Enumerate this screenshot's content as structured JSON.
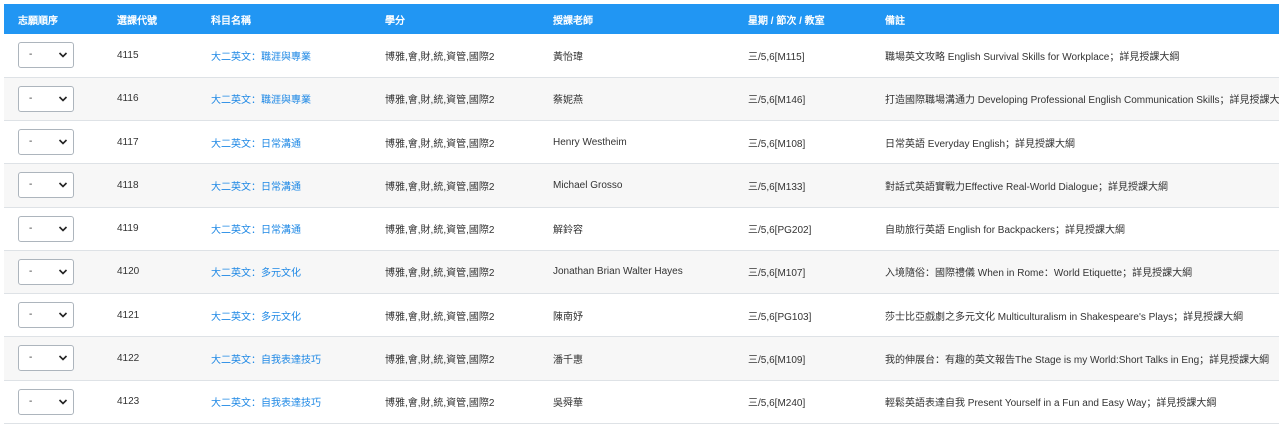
{
  "headers": {
    "order": "志願順序",
    "code": "選課代號",
    "name": "科目名稱",
    "credit": "學分",
    "teacher": "授課老師",
    "time": "星期 / 節次 / 教室",
    "note": "備註"
  },
  "rows": [
    {
      "order": "-",
      "code": "4115",
      "name": "大二英文：職涯與專業",
      "credit": "博雅,會,財,統,資管,國際2",
      "teacher": "黃怡瑋",
      "time": "三/5,6[M115]",
      "note": "職場英文攻略 English Survival Skills for Workplace；詳見授課大綱"
    },
    {
      "order": "-",
      "code": "4116",
      "name": "大二英文：職涯與專業",
      "credit": "博雅,會,財,統,資管,國際2",
      "teacher": "蔡妮燕",
      "time": "三/5,6[M146]",
      "note": "打造國際職場溝通力 Developing Professional English Communication Skills；詳見授課大綱"
    },
    {
      "order": "-",
      "code": "4117",
      "name": "大二英文：日常溝通",
      "credit": "博雅,會,財,統,資管,國際2",
      "teacher": "Henry Westheim",
      "time": "三/5,6[M108]",
      "note": "日常英語 Everyday English；詳見授課大綱"
    },
    {
      "order": "-",
      "code": "4118",
      "name": "大二英文：日常溝通",
      "credit": "博雅,會,財,統,資管,國際2",
      "teacher": "Michael Grosso",
      "time": "三/5,6[M133]",
      "note": "對話式英語實戰力Effective Real-World Dialogue；詳見授課大綱"
    },
    {
      "order": "-",
      "code": "4119",
      "name": "大二英文：日常溝通",
      "credit": "博雅,會,財,統,資管,國際2",
      "teacher": "解鈴容",
      "time": "三/5,6[PG202]",
      "note": "自助旅行英語 English for Backpackers；詳見授課大綱"
    },
    {
      "order": "-",
      "code": "4120",
      "name": "大二英文：多元文化",
      "credit": "博雅,會,財,統,資管,國際2",
      "teacher": "Jonathan Brian Walter Hayes",
      "time": "三/5,6[M107]",
      "note": "入境隨俗：國際禮儀 When in Rome：World Etiquette；詳見授課大綱"
    },
    {
      "order": "-",
      "code": "4121",
      "name": "大二英文：多元文化",
      "credit": "博雅,會,財,統,資管,國際2",
      "teacher": "陳南妤",
      "time": "三/5,6[PG103]",
      "note": "莎士比亞戲劇之多元文化 Multiculturalism in Shakespeare's Plays；詳見授課大綱"
    },
    {
      "order": "-",
      "code": "4122",
      "name": "大二英文：自我表達技巧",
      "credit": "博雅,會,財,統,資管,國際2",
      "teacher": "潘千惠",
      "time": "三/5,6[M109]",
      "note": "我的伸展台：有趣的英文報告The Stage is my World:Short Talks in Eng；詳見授課大綱"
    },
    {
      "order": "-",
      "code": "4123",
      "name": "大二英文：自我表達技巧",
      "credit": "博雅,會,財,統,資管,國際2",
      "teacher": "吳舜華",
      "time": "三/5,6[M240]",
      "note": "輕鬆英語表達自我 Present Yourself in a Fun and Easy Way；詳見授課大綱"
    }
  ],
  "icons": {
    "select_arrow": "chevron-down-icon"
  },
  "colors": {
    "header_bg": "#2196f3",
    "link": "#1e88e5"
  }
}
